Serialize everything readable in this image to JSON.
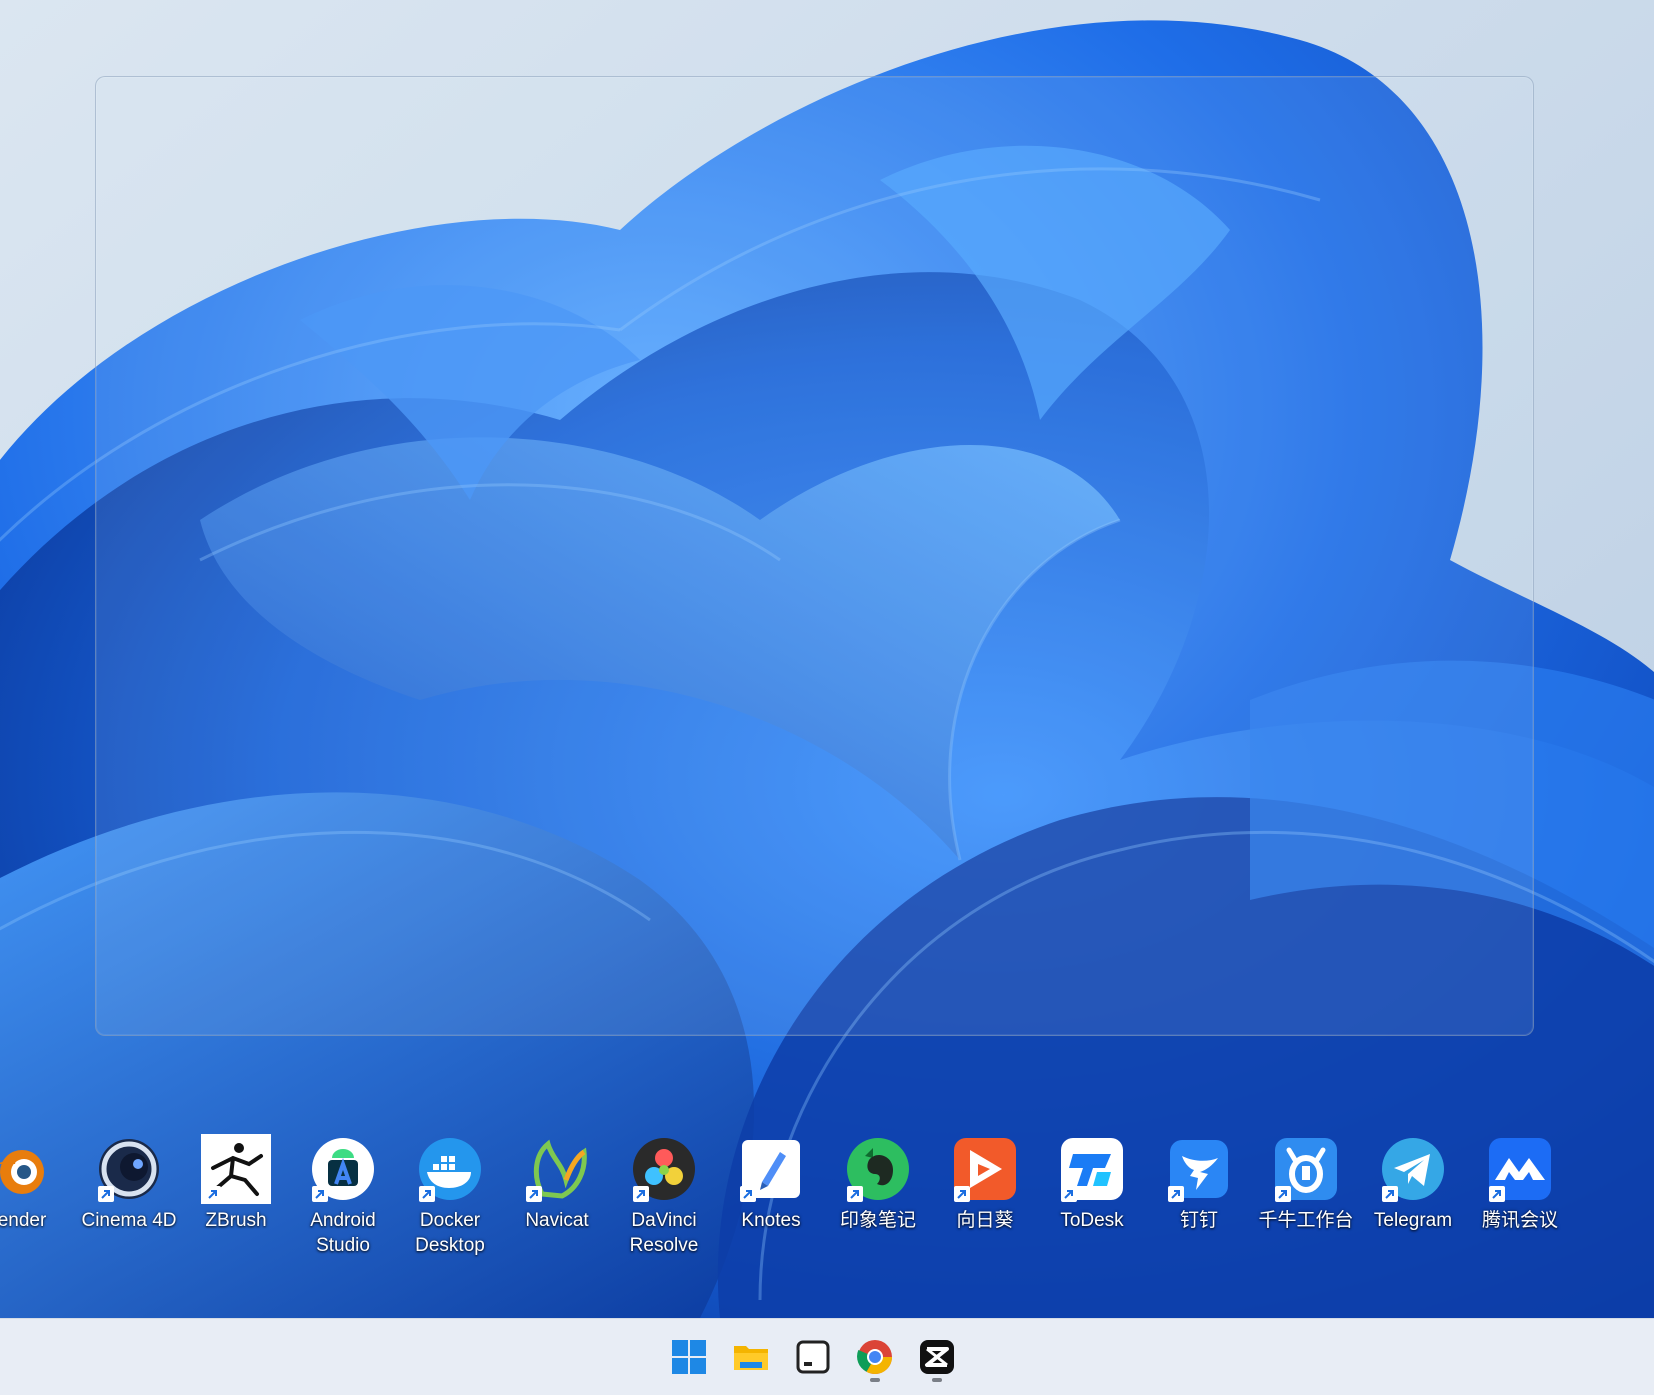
{
  "desktop": {
    "icons": [
      {
        "label": "ender",
        "icon": "blender-icon"
      },
      {
        "label": "Cinema 4D",
        "icon": "cinema4d-icon"
      },
      {
        "label": "ZBrush",
        "icon": "zbrush-icon"
      },
      {
        "label": "Android\nStudio",
        "icon": "android-studio-icon"
      },
      {
        "label": "Docker\nDesktop",
        "icon": "docker-icon"
      },
      {
        "label": "Navicat",
        "icon": "navicat-icon"
      },
      {
        "label": "DaVinci\nResolve",
        "icon": "davinci-resolve-icon"
      },
      {
        "label": "Knotes",
        "icon": "knotes-icon"
      },
      {
        "label": "印象笔记",
        "icon": "evernote-icon"
      },
      {
        "label": "向日葵",
        "icon": "sunlogin-icon"
      },
      {
        "label": "ToDesk",
        "icon": "todesk-icon"
      },
      {
        "label": "钉钉",
        "icon": "dingtalk-icon"
      },
      {
        "label": "千牛工作台",
        "icon": "qianniu-icon"
      },
      {
        "label": "Telegram",
        "icon": "telegram-icon"
      },
      {
        "label": "腾讯会议",
        "icon": "tencent-meeting-icon"
      }
    ]
  },
  "taskbar": {
    "icons": [
      {
        "name": "start-icon",
        "running": false
      },
      {
        "name": "file-explorer-icon",
        "running": false
      },
      {
        "name": "terminal-icon",
        "running": false
      },
      {
        "name": "chrome-icon",
        "running": true
      },
      {
        "name": "capcut-icon",
        "running": true
      }
    ]
  },
  "colors": {
    "accent": "#1a6de0",
    "wallpaper_bg": "#c6d6e8",
    "taskbar_bg": "#e8edf5"
  }
}
